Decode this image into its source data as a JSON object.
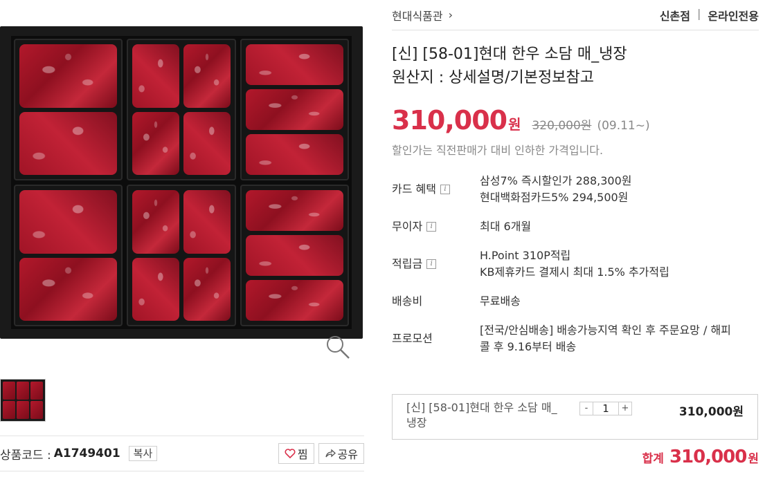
{
  "breadcrumb": {
    "label": "현대식품관",
    "chevron": "›"
  },
  "store": {
    "branch": "신촌점",
    "separator": "|",
    "tag": "온라인전용"
  },
  "product": {
    "title_line1": "[신] [58-01]현대 한우 소담 매_냉장",
    "title_line2": "원산지 : 상세설명/기본정보참고",
    "price": "310,000",
    "price_unit": "원",
    "original_price": "320,000원",
    "price_date": "(09.11~)",
    "discount_note": "할인가는 직전판매가 대비 인하한 가격입니다."
  },
  "details": [
    {
      "label": "카드 혜택",
      "has_info": true,
      "lines": [
        "삼성7% 즉시할인가 288,300원",
        "현대백화점카드5% 294,500원"
      ]
    },
    {
      "label": "무이자",
      "has_info": true,
      "lines": [
        "최대 6개월"
      ]
    },
    {
      "label": "적립금",
      "has_info": true,
      "lines": [
        "H.Point 310P적립",
        "KB제휴카드 결제시 최대 1.5% 추가적립"
      ]
    },
    {
      "label": "배송비",
      "has_info": false,
      "lines": [
        "무료배송"
      ]
    },
    {
      "label": "프로모션",
      "has_info": false,
      "lines": [
        "[전국/안심배송] 배송가능지역 확인 후 주문요망 / 해피",
        "콜 후 9.16부터 배송"
      ]
    }
  ],
  "info_icon": "i",
  "code": {
    "label": "상품코드 :",
    "value": "A1749401",
    "copy_label": "복사"
  },
  "actions": {
    "wish_label": "찜",
    "share_label": "공유"
  },
  "order": {
    "name_line1": "[신] [58-01]현대 한우 소담 매_",
    "name_line2": "냉장",
    "minus": "-",
    "quantity": "1",
    "plus": "+",
    "price": "310,000원"
  },
  "total": {
    "label": "합계",
    "value": "310,000",
    "unit": "원"
  },
  "colors": {
    "accent": "#d9304a",
    "border": "#cfcfcf",
    "muted": "#888888"
  },
  "icons": [
    "zoom-icon",
    "heart-icon",
    "share-icon",
    "chevron-right-icon",
    "info-icon"
  ]
}
